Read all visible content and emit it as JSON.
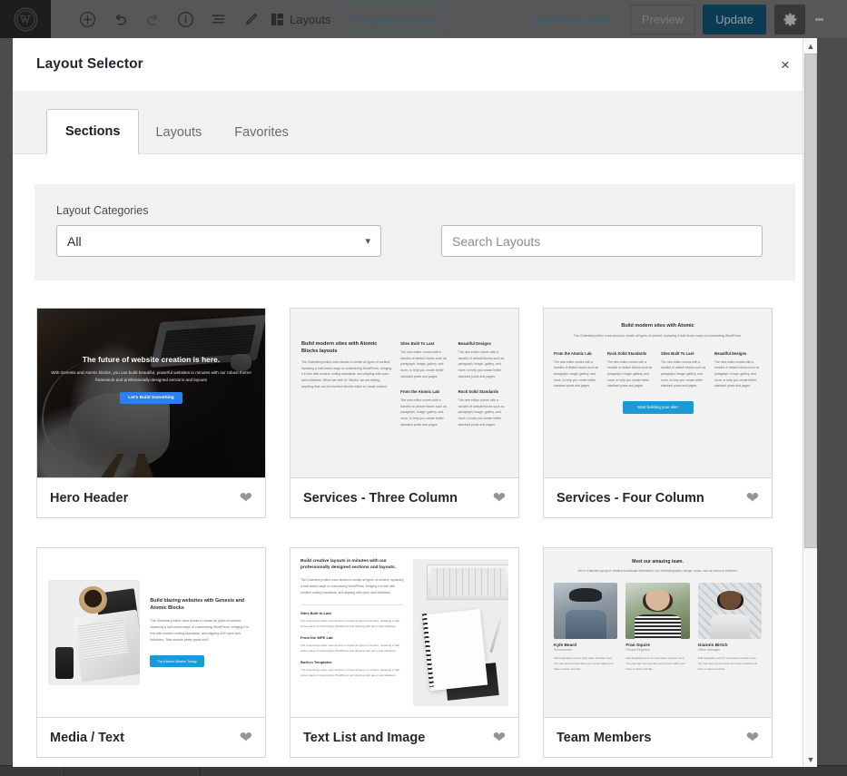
{
  "toolbar": {
    "logo_title": "WordPress",
    "icons": [
      "add-block-icon",
      "undo-icon",
      "redo-icon",
      "info-icon",
      "list-view-icon",
      "edit-pencil-icon"
    ],
    "layouts_label": "Layouts",
    "template_library_label": "Template Library",
    "switch_to_draft_label": "Switch to draft",
    "preview_label": "Preview",
    "update_label": "Update",
    "settings_icon": "gear-icon",
    "more_icon": "kebab-menu-icon",
    "colors": {
      "bar_bg": "#575757",
      "update_bg": "#0b3c54",
      "link": "#3a5c6e"
    }
  },
  "modal": {
    "title": "Layout Selector",
    "close_label": "×",
    "tabs": [
      {
        "label": "Sections",
        "active": true
      },
      {
        "label": "Layouts",
        "active": false
      },
      {
        "label": "Favorites",
        "active": false
      }
    ]
  },
  "filters": {
    "category_label": "Layout Categories",
    "category_value": "All",
    "category_caret": "chevron-down-icon",
    "search_placeholder": "Search Layouts",
    "search_value": ""
  },
  "cards": [
    {
      "title": "Hero Header",
      "favorite_icon": "heart-icon",
      "preview": {
        "kind": "hero",
        "heading": "The future of website creation is here.",
        "paragraph": "With Genesis and Atomic blocks, you can build beautiful, powerful websites in minutes with our robust theme framework and professionally-designed sections and layouts",
        "button": "Let's Build Something",
        "button_color": "#2d7ff0"
      }
    },
    {
      "title": "Services - Three Column",
      "favorite_icon": "heart-icon",
      "preview": {
        "kind": "three-column",
        "main_heading": "Build modern sites with Atomic Blocks layouts",
        "main_paragraph": "The Gutenberg editor uses blocks to create all types of content, replacing a half-dozen ways of customizing WordPress, bringing it in line with modern coding standards, and aligning with open web initiatives. When we refer to \"blocks\" we are talking anything that can be inserted into the editor to create content.",
        "columns": [
          {
            "heading": "Sites Built To Last",
            "body": "The new editor comes with a handful of default blocks such as paragraph, image, gallery, and more, to help you create better standard posts and pages."
          },
          {
            "heading": "Beautiful Designs",
            "body": "The new editor comes with a handful of default blocks such as paragraph, image, gallery, and more, to help you create better standard posts and pages."
          },
          {
            "heading": "From the Atomic Lab",
            "body": "The new editor comes with a handful of default blocks such as paragraph, image, gallery, and more, to help you create better standard posts and pages."
          },
          {
            "heading": "Rock Solid Standards",
            "body": "The new editor comes with a handful of default blocks such as paragraph, image, gallery, and more, to help you create better standard posts and pages."
          }
        ]
      }
    },
    {
      "title": "Services - Four Column",
      "favorite_icon": "heart-icon",
      "preview": {
        "kind": "four-column",
        "heading": "Build modern sites with Atomic",
        "subheading": "The Gutenberg editor uses blocks to create all types of content, replacing a half-dozen ways of customizing WordPress.",
        "columns": [
          {
            "heading": "From the Atomic Lab",
            "body": "The new editor comes with a handful of default blocks such as paragraph, image, gallery, and more, to help you create better standard posts and pages."
          },
          {
            "heading": "Rock Solid Standards",
            "body": "The new editor comes with a handful of default blocks such as paragraph, image, gallery, and more, to help you create better standard posts and pages."
          },
          {
            "heading": "Sites Built To Last",
            "body": "The new editor comes with a handful of default blocks such as paragraph, image, gallery, and more, to help you create better standard posts and pages."
          },
          {
            "heading": "Beautiful Designs",
            "body": "The new editor comes with a handful of default blocks such as paragraph, image, gallery, and more, to help you create better standard posts and pages."
          }
        ],
        "button": "Start building your site!",
        "button_color": "#1b9ad6"
      }
    },
    {
      "title": "Media / Text",
      "favorite_icon": "heart-icon",
      "preview": {
        "kind": "media-text",
        "heading": "Build blazing websites with Genesis and Atomic Blocks",
        "paragraph": "The Gutenberg editor uses blocks to create all types of content, replacing a half-dozen ways of customizing WordPress, bringing it in line with modern coding standards, and aligning with open web initiatives. That sounds pretty great huh?",
        "button": "Try Atomic Blocks Today",
        "button_color": "#1b9ad6"
      }
    },
    {
      "title": "Text List and Image",
      "favorite_icon": "heart-icon",
      "preview": {
        "kind": "text-list-image",
        "heading": "Build creative layouts in minutes with our professionally designed sections and layouts.",
        "paragraph": "The Gutenberg editor uses blocks to create all types of content, replacing a half-dozen ways of customizing WordPress, bringing it in line with modern coding standards, and aligning with open web initiatives.",
        "items": [
          {
            "heading": "Sites Built to Last",
            "body": "The Gutenberg editor uses blocks to create all types of content, replacing a half-dozen ways of customizing WordPress and aligning with open web initiatives."
          },
          {
            "heading": "From the WPE Lab",
            "body": "The Gutenberg editor uses blocks to create all types of content, replacing a half-dozen ways of customizing WordPress and aligning with open web initiatives."
          },
          {
            "heading": "Built-in Templates",
            "body": "The Gutenberg editor uses blocks to create all types of content, replacing a half-dozen ways of customizing WordPress and aligning with open web initiatives."
          }
        ]
      }
    },
    {
      "title": "Team Members",
      "favorite_icon": "heart-icon",
      "preview": {
        "kind": "team",
        "heading": "Meet our amazing team.",
        "subheading": "We're a talented group of creative individuals interested in art, cinematography, design, music, and all niches in between.",
        "members": [
          {
            "name": "Kyle Beard",
            "role": "Screenwriter",
            "bio": "Add biography text for your team member here. You can also remove this text if you'd rather just have a name and title."
          },
          {
            "name": "Fran Squire",
            "role": "People Engineer",
            "bio": "Add biography text for your team member here. You can also remove this text if you'd rather just have a name and title."
          },
          {
            "name": "Giannis Birtch",
            "role": "Office Manager",
            "bio": "Add biography text for your team member here. You can also remove this text if you'd rather just have a name and title."
          }
        ]
      }
    }
  ],
  "scrollbar": {
    "up_icon": "chevron-up-icon",
    "down_icon": "chevron-down-icon"
  }
}
